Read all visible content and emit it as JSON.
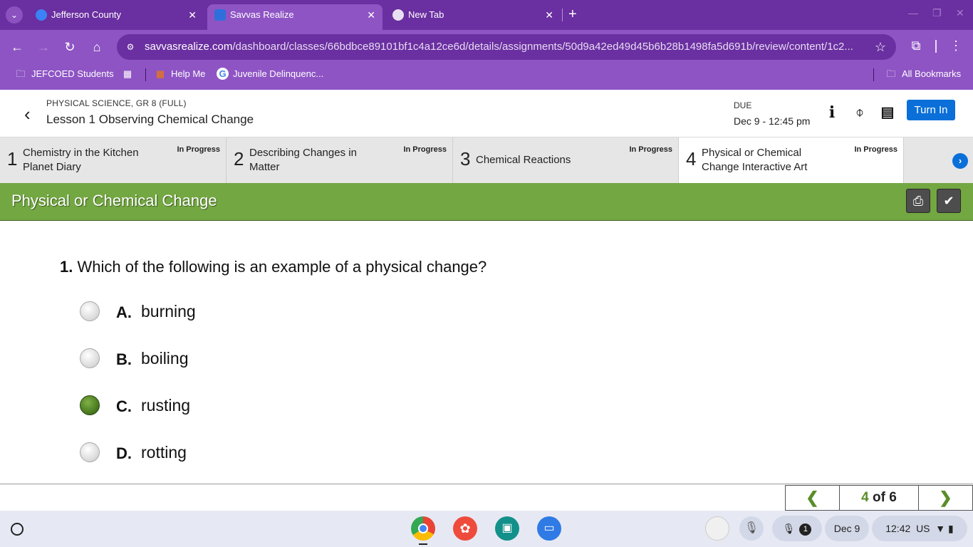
{
  "browser": {
    "tabs": [
      {
        "title": "Jefferson County",
        "close": "✕"
      },
      {
        "title": "Savvas Realize",
        "close": "✕"
      },
      {
        "title": "New Tab",
        "close": "✕"
      }
    ],
    "new_tab": "+",
    "url_host": "savvasrealize.com",
    "url_path": "/dashboard/classes/66bdbce89101bf1c4a12ce6d/details/assignments/50d9a42ed49d45b6b28b1498fa5d691b/review/content/1c2...",
    "bookmarks": [
      {
        "label": "JEFCOED Students"
      },
      {
        "label": "Help Me"
      },
      {
        "label": "Juvenile Delinquenc..."
      }
    ],
    "all_bookmarks": "All Bookmarks"
  },
  "header": {
    "course": "PHYSICAL SCIENCE, GR 8 (FULL)",
    "lesson": "Lesson 1 Observing Chemical Change",
    "due_label": "DUE",
    "due_date": "Dec 9 - 12:45 pm",
    "turn_in": "Turn In"
  },
  "steps": [
    {
      "num": "1",
      "title": "Chemistry in the Kitchen Planet Diary",
      "status": "In Progress"
    },
    {
      "num": "2",
      "title": "Describing Changes in Matter",
      "status": "In Progress"
    },
    {
      "num": "3",
      "title": "Chemical Reactions",
      "status": "In Progress"
    },
    {
      "num": "4",
      "title": "Physical or Chemical Change Interactive Art",
      "status": "In Progress"
    }
  ],
  "content": {
    "title": "Physical or Chemical Change",
    "question_num": "1.",
    "question": "Which of the following is an example of a physical change?",
    "choices": [
      {
        "letter": "A.",
        "text": "burning",
        "selected": false
      },
      {
        "letter": "B.",
        "text": "boiling",
        "selected": false
      },
      {
        "letter": "C.",
        "text": "rusting",
        "selected": true
      },
      {
        "letter": "D.",
        "text": "rotting",
        "selected": false
      }
    ]
  },
  "pager": {
    "current": "4",
    "of_total": "of 6",
    "prev": "❮",
    "next": "❯"
  },
  "shelf": {
    "notifications": "1",
    "date": "Dec 9",
    "time": "12:42",
    "locale": "US"
  },
  "colors": {
    "chrome_purple": "#6a2fa0",
    "toolbar_purple": "#8e54c4",
    "accent_blue": "#0a6fd9",
    "content_green": "#73a742"
  }
}
